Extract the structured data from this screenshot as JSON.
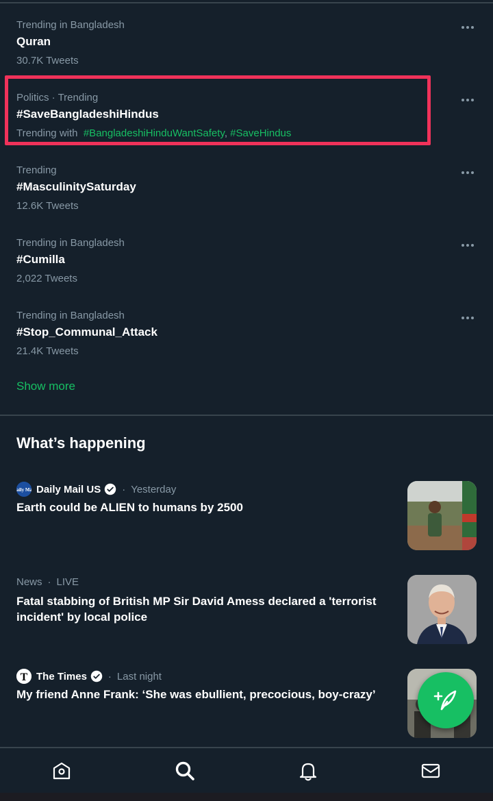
{
  "trends": [
    {
      "meta": "Trending in Bangladesh",
      "name": "Quran",
      "count": "30.7K Tweets"
    },
    {
      "meta": "Politics · Trending",
      "name": "#SaveBangladeshiHindus",
      "with_prefix": "Trending with",
      "with_tag1": "#BangladeshiHinduWantSafety",
      "with_sep": ",",
      "with_tag2": "#SaveHindus"
    },
    {
      "meta": "Trending",
      "name": "#MasculinitySaturday",
      "count": "12.6K Tweets"
    },
    {
      "meta": "Trending in Bangladesh",
      "name": "#Cumilla",
      "count": "2,022 Tweets"
    },
    {
      "meta": "Trending in Bangladesh",
      "name": "#Stop_Communal_Attack",
      "count": "21.4K Tweets"
    }
  ],
  "show_more": "Show more",
  "section_title": "What’s happening",
  "stories": [
    {
      "source": "Daily Mail US",
      "verified": true,
      "time": "Yesterday",
      "headline": "Earth could be ALIEN to humans by 2500",
      "logo_text": "Daily Mail"
    },
    {
      "category": "News",
      "status": "LIVE",
      "headline": "Fatal stabbing of British MP Sir David Amess declared a 'terrorist incident' by local police"
    },
    {
      "source": "The Times",
      "verified": true,
      "time": "Last night",
      "headline": "My friend Anne Frank: ‘She was ebullient, precocious, boy-crazy’",
      "logo_text": "T"
    }
  ],
  "dot": "·",
  "icons": {
    "more": "more-horizontal-icon",
    "verified": "verified-badge-icon",
    "compose": "compose-tweet-icon",
    "home": "home-icon",
    "search": "search-icon",
    "notifications": "bell-icon",
    "messages": "envelope-icon"
  },
  "colors": {
    "background": "#15202b",
    "accent": "#17bf63",
    "secondary_text": "#8899a6",
    "divider": "#38444d",
    "highlight": "#f0325a"
  }
}
